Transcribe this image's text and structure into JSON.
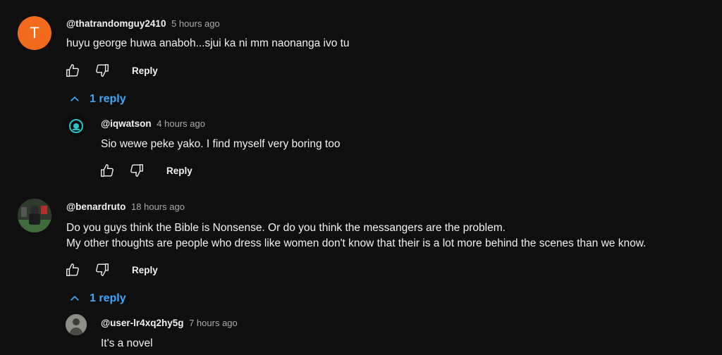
{
  "comments": [
    {
      "avatar_letter": "T",
      "author": "@thatrandomguy2410",
      "time": "5 hours ago",
      "text": "huyu george huwa anaboh...sjui ka ni mm naonanga ivo tu",
      "reply_label": "Reply",
      "replies_toggle": "1 reply",
      "reply": {
        "author": "@iqwatson",
        "time": "4 hours ago",
        "text": "Sio wewe peke yako. I find myself very boring too",
        "reply_label": "Reply"
      }
    },
    {
      "author": "@benardruto",
      "time": "18 hours ago",
      "text_line1": "Do you guys think the Bible is Nonsense. Or do you think the messangers are the problem.",
      "text_line2": "My other thoughts are people who dress like women don't know that their is a lot more behind the scenes than we know.",
      "reply_label": "Reply",
      "replies_toggle": "1 reply",
      "reply": {
        "author": "@user-lr4xq2hy5g",
        "time": "7 hours ago",
        "text": "It's a novel"
      }
    }
  ],
  "colors": {
    "background": "#0f0f0f",
    "link": "#3ea6ff",
    "avatar_orange": "#f26b1d",
    "muted": "#aaaaaa"
  }
}
